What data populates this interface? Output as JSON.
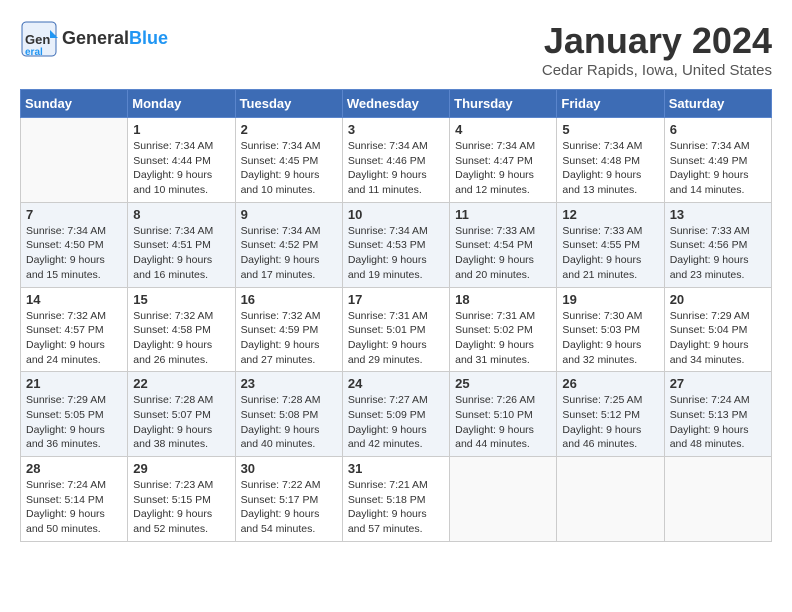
{
  "logo": {
    "general": "General",
    "blue": "Blue"
  },
  "title": "January 2024",
  "location": "Cedar Rapids, Iowa, United States",
  "days_of_week": [
    "Sunday",
    "Monday",
    "Tuesday",
    "Wednesday",
    "Thursday",
    "Friday",
    "Saturday"
  ],
  "weeks": [
    [
      {
        "day": "",
        "sunrise": "",
        "sunset": "",
        "daylight": ""
      },
      {
        "day": "1",
        "sunrise": "Sunrise: 7:34 AM",
        "sunset": "Sunset: 4:44 PM",
        "daylight": "Daylight: 9 hours and 10 minutes."
      },
      {
        "day": "2",
        "sunrise": "Sunrise: 7:34 AM",
        "sunset": "Sunset: 4:45 PM",
        "daylight": "Daylight: 9 hours and 10 minutes."
      },
      {
        "day": "3",
        "sunrise": "Sunrise: 7:34 AM",
        "sunset": "Sunset: 4:46 PM",
        "daylight": "Daylight: 9 hours and 11 minutes."
      },
      {
        "day": "4",
        "sunrise": "Sunrise: 7:34 AM",
        "sunset": "Sunset: 4:47 PM",
        "daylight": "Daylight: 9 hours and 12 minutes."
      },
      {
        "day": "5",
        "sunrise": "Sunrise: 7:34 AM",
        "sunset": "Sunset: 4:48 PM",
        "daylight": "Daylight: 9 hours and 13 minutes."
      },
      {
        "day": "6",
        "sunrise": "Sunrise: 7:34 AM",
        "sunset": "Sunset: 4:49 PM",
        "daylight": "Daylight: 9 hours and 14 minutes."
      }
    ],
    [
      {
        "day": "7",
        "sunrise": "Sunrise: 7:34 AM",
        "sunset": "Sunset: 4:50 PM",
        "daylight": "Daylight: 9 hours and 15 minutes."
      },
      {
        "day": "8",
        "sunrise": "Sunrise: 7:34 AM",
        "sunset": "Sunset: 4:51 PM",
        "daylight": "Daylight: 9 hours and 16 minutes."
      },
      {
        "day": "9",
        "sunrise": "Sunrise: 7:34 AM",
        "sunset": "Sunset: 4:52 PM",
        "daylight": "Daylight: 9 hours and 17 minutes."
      },
      {
        "day": "10",
        "sunrise": "Sunrise: 7:34 AM",
        "sunset": "Sunset: 4:53 PM",
        "daylight": "Daylight: 9 hours and 19 minutes."
      },
      {
        "day": "11",
        "sunrise": "Sunrise: 7:33 AM",
        "sunset": "Sunset: 4:54 PM",
        "daylight": "Daylight: 9 hours and 20 minutes."
      },
      {
        "day": "12",
        "sunrise": "Sunrise: 7:33 AM",
        "sunset": "Sunset: 4:55 PM",
        "daylight": "Daylight: 9 hours and 21 minutes."
      },
      {
        "day": "13",
        "sunrise": "Sunrise: 7:33 AM",
        "sunset": "Sunset: 4:56 PM",
        "daylight": "Daylight: 9 hours and 23 minutes."
      }
    ],
    [
      {
        "day": "14",
        "sunrise": "Sunrise: 7:32 AM",
        "sunset": "Sunset: 4:57 PM",
        "daylight": "Daylight: 9 hours and 24 minutes."
      },
      {
        "day": "15",
        "sunrise": "Sunrise: 7:32 AM",
        "sunset": "Sunset: 4:58 PM",
        "daylight": "Daylight: 9 hours and 26 minutes."
      },
      {
        "day": "16",
        "sunrise": "Sunrise: 7:32 AM",
        "sunset": "Sunset: 4:59 PM",
        "daylight": "Daylight: 9 hours and 27 minutes."
      },
      {
        "day": "17",
        "sunrise": "Sunrise: 7:31 AM",
        "sunset": "Sunset: 5:01 PM",
        "daylight": "Daylight: 9 hours and 29 minutes."
      },
      {
        "day": "18",
        "sunrise": "Sunrise: 7:31 AM",
        "sunset": "Sunset: 5:02 PM",
        "daylight": "Daylight: 9 hours and 31 minutes."
      },
      {
        "day": "19",
        "sunrise": "Sunrise: 7:30 AM",
        "sunset": "Sunset: 5:03 PM",
        "daylight": "Daylight: 9 hours and 32 minutes."
      },
      {
        "day": "20",
        "sunrise": "Sunrise: 7:29 AM",
        "sunset": "Sunset: 5:04 PM",
        "daylight": "Daylight: 9 hours and 34 minutes."
      }
    ],
    [
      {
        "day": "21",
        "sunrise": "Sunrise: 7:29 AM",
        "sunset": "Sunset: 5:05 PM",
        "daylight": "Daylight: 9 hours and 36 minutes."
      },
      {
        "day": "22",
        "sunrise": "Sunrise: 7:28 AM",
        "sunset": "Sunset: 5:07 PM",
        "daylight": "Daylight: 9 hours and 38 minutes."
      },
      {
        "day": "23",
        "sunrise": "Sunrise: 7:28 AM",
        "sunset": "Sunset: 5:08 PM",
        "daylight": "Daylight: 9 hours and 40 minutes."
      },
      {
        "day": "24",
        "sunrise": "Sunrise: 7:27 AM",
        "sunset": "Sunset: 5:09 PM",
        "daylight": "Daylight: 9 hours and 42 minutes."
      },
      {
        "day": "25",
        "sunrise": "Sunrise: 7:26 AM",
        "sunset": "Sunset: 5:10 PM",
        "daylight": "Daylight: 9 hours and 44 minutes."
      },
      {
        "day": "26",
        "sunrise": "Sunrise: 7:25 AM",
        "sunset": "Sunset: 5:12 PM",
        "daylight": "Daylight: 9 hours and 46 minutes."
      },
      {
        "day": "27",
        "sunrise": "Sunrise: 7:24 AM",
        "sunset": "Sunset: 5:13 PM",
        "daylight": "Daylight: 9 hours and 48 minutes."
      }
    ],
    [
      {
        "day": "28",
        "sunrise": "Sunrise: 7:24 AM",
        "sunset": "Sunset: 5:14 PM",
        "daylight": "Daylight: 9 hours and 50 minutes."
      },
      {
        "day": "29",
        "sunrise": "Sunrise: 7:23 AM",
        "sunset": "Sunset: 5:15 PM",
        "daylight": "Daylight: 9 hours and 52 minutes."
      },
      {
        "day": "30",
        "sunrise": "Sunrise: 7:22 AM",
        "sunset": "Sunset: 5:17 PM",
        "daylight": "Daylight: 9 hours and 54 minutes."
      },
      {
        "day": "31",
        "sunrise": "Sunrise: 7:21 AM",
        "sunset": "Sunset: 5:18 PM",
        "daylight": "Daylight: 9 hours and 57 minutes."
      },
      {
        "day": "",
        "sunrise": "",
        "sunset": "",
        "daylight": ""
      },
      {
        "day": "",
        "sunrise": "",
        "sunset": "",
        "daylight": ""
      },
      {
        "day": "",
        "sunrise": "",
        "sunset": "",
        "daylight": ""
      }
    ]
  ]
}
